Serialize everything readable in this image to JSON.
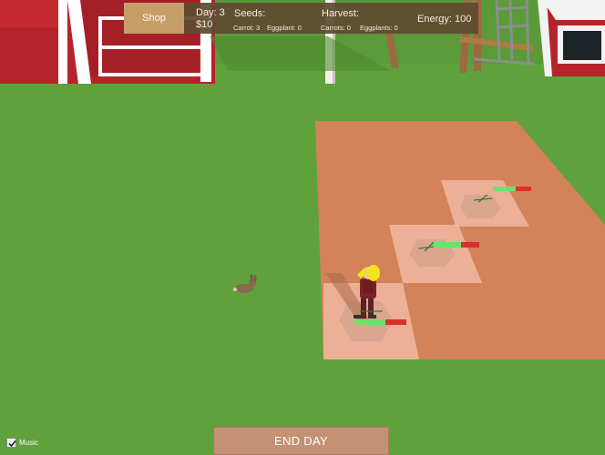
{
  "hud": {
    "shop_label": "Shop",
    "day_label": "Day: 3",
    "money": "$10",
    "seeds_label": "Seeds:",
    "seed_carrot": "Carrot: 3",
    "seed_eggplant": "Eggplant: 0",
    "harvest_label": "Harvest:",
    "harvest_carrots": "Carrots: 0",
    "harvest_eggplants": "Eggplants: 0",
    "energy_label": "Energy: 100"
  },
  "end_day_label": "END DAY",
  "music": {
    "label": "Music",
    "checked": true
  },
  "plots": [
    {
      "growth": 0.6
    },
    {
      "growth": 0.6
    },
    {
      "growth": 0.6
    }
  ],
  "colors": {
    "grass": "#5fa23c",
    "soil": "#d3825a",
    "barn_red": "#b5242b",
    "hud_bg": "#604a30",
    "shop_button": "#c59e6a",
    "end_day_button": "#c49175",
    "growth_fill": "#6fe06a",
    "growth_empty": "#d9302e"
  },
  "icons": [
    "checkmark-icon",
    "rabbit-icon",
    "farmer-icon",
    "sprout-icon"
  ]
}
